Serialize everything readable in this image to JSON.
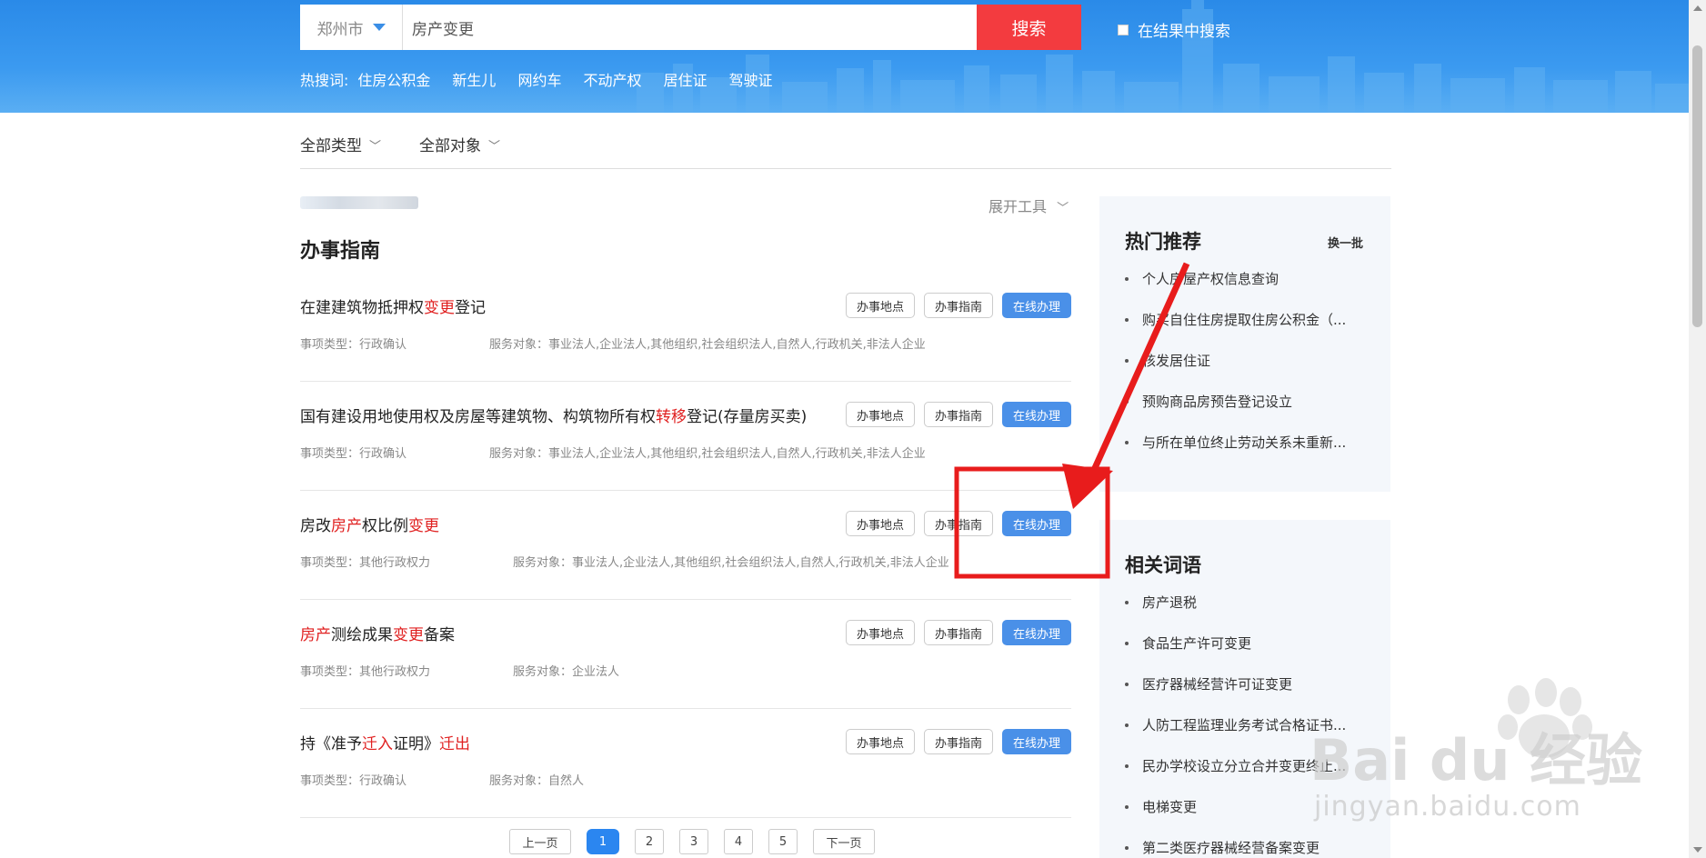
{
  "header": {
    "city": "郑州市",
    "search_value": "房产变更",
    "search_button": "搜索",
    "in_results_label": "在结果中搜索",
    "hotwords_label": "热搜词:",
    "hotwords": [
      "住房公积金",
      "新生儿",
      "网约车",
      "不动产权",
      "居住证",
      "驾驶证"
    ]
  },
  "filters": {
    "type_label": "全部类型",
    "target_label": "全部对象"
  },
  "tools_label": "展开工具",
  "section_title": "办事指南",
  "button_labels": {
    "location": "办事地点",
    "guide": "办事指南",
    "online": "在线办理"
  },
  "results": [
    {
      "title_parts": [
        "在建建筑物抵押权",
        "变更",
        "登记"
      ],
      "type": "事项类型：行政确认",
      "target": "服务对象：事业法人,企业法人,其他组织,社会组织法人,自然人,行政机关,非法人企业"
    },
    {
      "title_parts": [
        "国有建设用地使用权及房屋等建筑物、构筑物所有权",
        "转移",
        "登记(存量房买卖)"
      ],
      "type": "事项类型：行政确认",
      "target": "服务对象：事业法人,企业法人,其他组织,社会组织法人,自然人,行政机关,非法人企业"
    },
    {
      "title_parts": [
        "房改",
        "房产",
        "权比例",
        "变更",
        ""
      ],
      "type": "事项类型：其他行政权力",
      "target": "服务对象：事业法人,企业法人,其他组织,社会组织法人,自然人,行政机关,非法人企业"
    },
    {
      "title_parts": [
        "",
        "房产",
        "测绘成果",
        "变更",
        "备案"
      ],
      "type": "事项类型：其他行政权力",
      "target": "服务对象：企业法人"
    },
    {
      "title_parts": [
        "持《准予",
        "迁入",
        "证明》",
        "迁出",
        ""
      ],
      "type": "事项类型：行政确认",
      "target": "服务对象：自然人"
    }
  ],
  "pagination": {
    "prev": "上一页",
    "pages": [
      "1",
      "2",
      "3",
      "4",
      "5"
    ],
    "current": "1",
    "next": "下一页"
  },
  "hot": {
    "title": "热门推荐",
    "refresh": "换一批",
    "items": [
      "个人房屋产权信息查询",
      "购买自住住房提取住房公积金（...",
      "核发居住证",
      "预购商品房预告登记设立",
      "与所在单位终止劳动关系未重新..."
    ]
  },
  "related": {
    "title": "相关词语",
    "items": [
      "房产退税",
      "食品生产许可变更",
      "医疗器械经营许可证变更",
      "人防工程监理业务考试合格证书...",
      "民办学校设立分立合并变更终止...",
      "电梯变更",
      "第二类医疗器械经营备案变更"
    ]
  },
  "watermark": {
    "text": "jingyan.baidu.com",
    "logo_text": "Bai du 经验"
  },
  "colors": {
    "header_blue": "#2a8ae8",
    "search_red": "#f33b3f",
    "primary_blue": "#4a90e8",
    "highlight_red": "#e02020",
    "annotation_red": "#e81c1c"
  }
}
